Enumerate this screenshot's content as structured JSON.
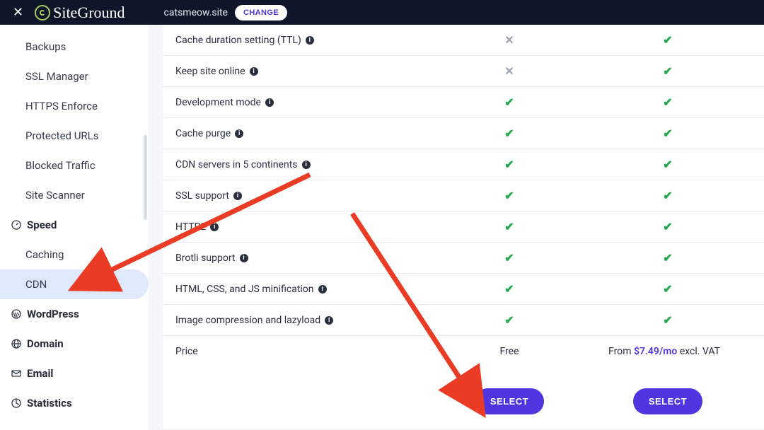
{
  "header": {
    "brand": "SiteGround",
    "site": "catsmeow.site",
    "change_label": "CHANGE"
  },
  "sidebar": {
    "items_sec1": [
      {
        "label": "Backups"
      },
      {
        "label": "SSL Manager"
      },
      {
        "label": "HTTPS Enforce"
      },
      {
        "label": "Protected URLs"
      },
      {
        "label": "Blocked Traffic"
      },
      {
        "label": "Site Scanner"
      }
    ],
    "section_speed": "Speed",
    "items_speed": [
      {
        "label": "Caching"
      },
      {
        "label": "CDN"
      }
    ],
    "section_wordpress": "WordPress",
    "section_domain": "Domain",
    "section_email": "Email",
    "section_statistics": "Statistics"
  },
  "colors": {
    "accent": "#4f35e0",
    "check": "#1eaa47",
    "cross": "#9ba1af",
    "header_bg": "#0f1629",
    "arrow": "#ea3b24"
  },
  "features": [
    {
      "label": "Cache duration setting (TTL)",
      "col1": "cross",
      "col2": "check"
    },
    {
      "label": "Keep site online",
      "col1": "cross",
      "col2": "check"
    },
    {
      "label": "Development mode",
      "col1": "check",
      "col2": "check"
    },
    {
      "label": "Cache purge",
      "col1": "check",
      "col2": "check"
    },
    {
      "label": "CDN servers in 5 continents",
      "col1": "check",
      "col2": "check"
    },
    {
      "label": "SSL support",
      "col1": "check",
      "col2": "check"
    },
    {
      "label": "HTTP2",
      "col1": "check",
      "col2": "check"
    },
    {
      "label": "Brotli support",
      "col1": "check",
      "col2": "check"
    },
    {
      "label": "HTML, CSS, and JS minification",
      "col1": "check",
      "col2": "check"
    },
    {
      "label": "Image compression and lazyload",
      "col1": "check",
      "col2": "check"
    }
  ],
  "price_row": {
    "label": "Price",
    "col1": "Free",
    "col2_prefix": "From ",
    "col2_price": "$7.49/mo",
    "col2_suffix": " excl. VAT"
  },
  "select_label": "SELECT"
}
